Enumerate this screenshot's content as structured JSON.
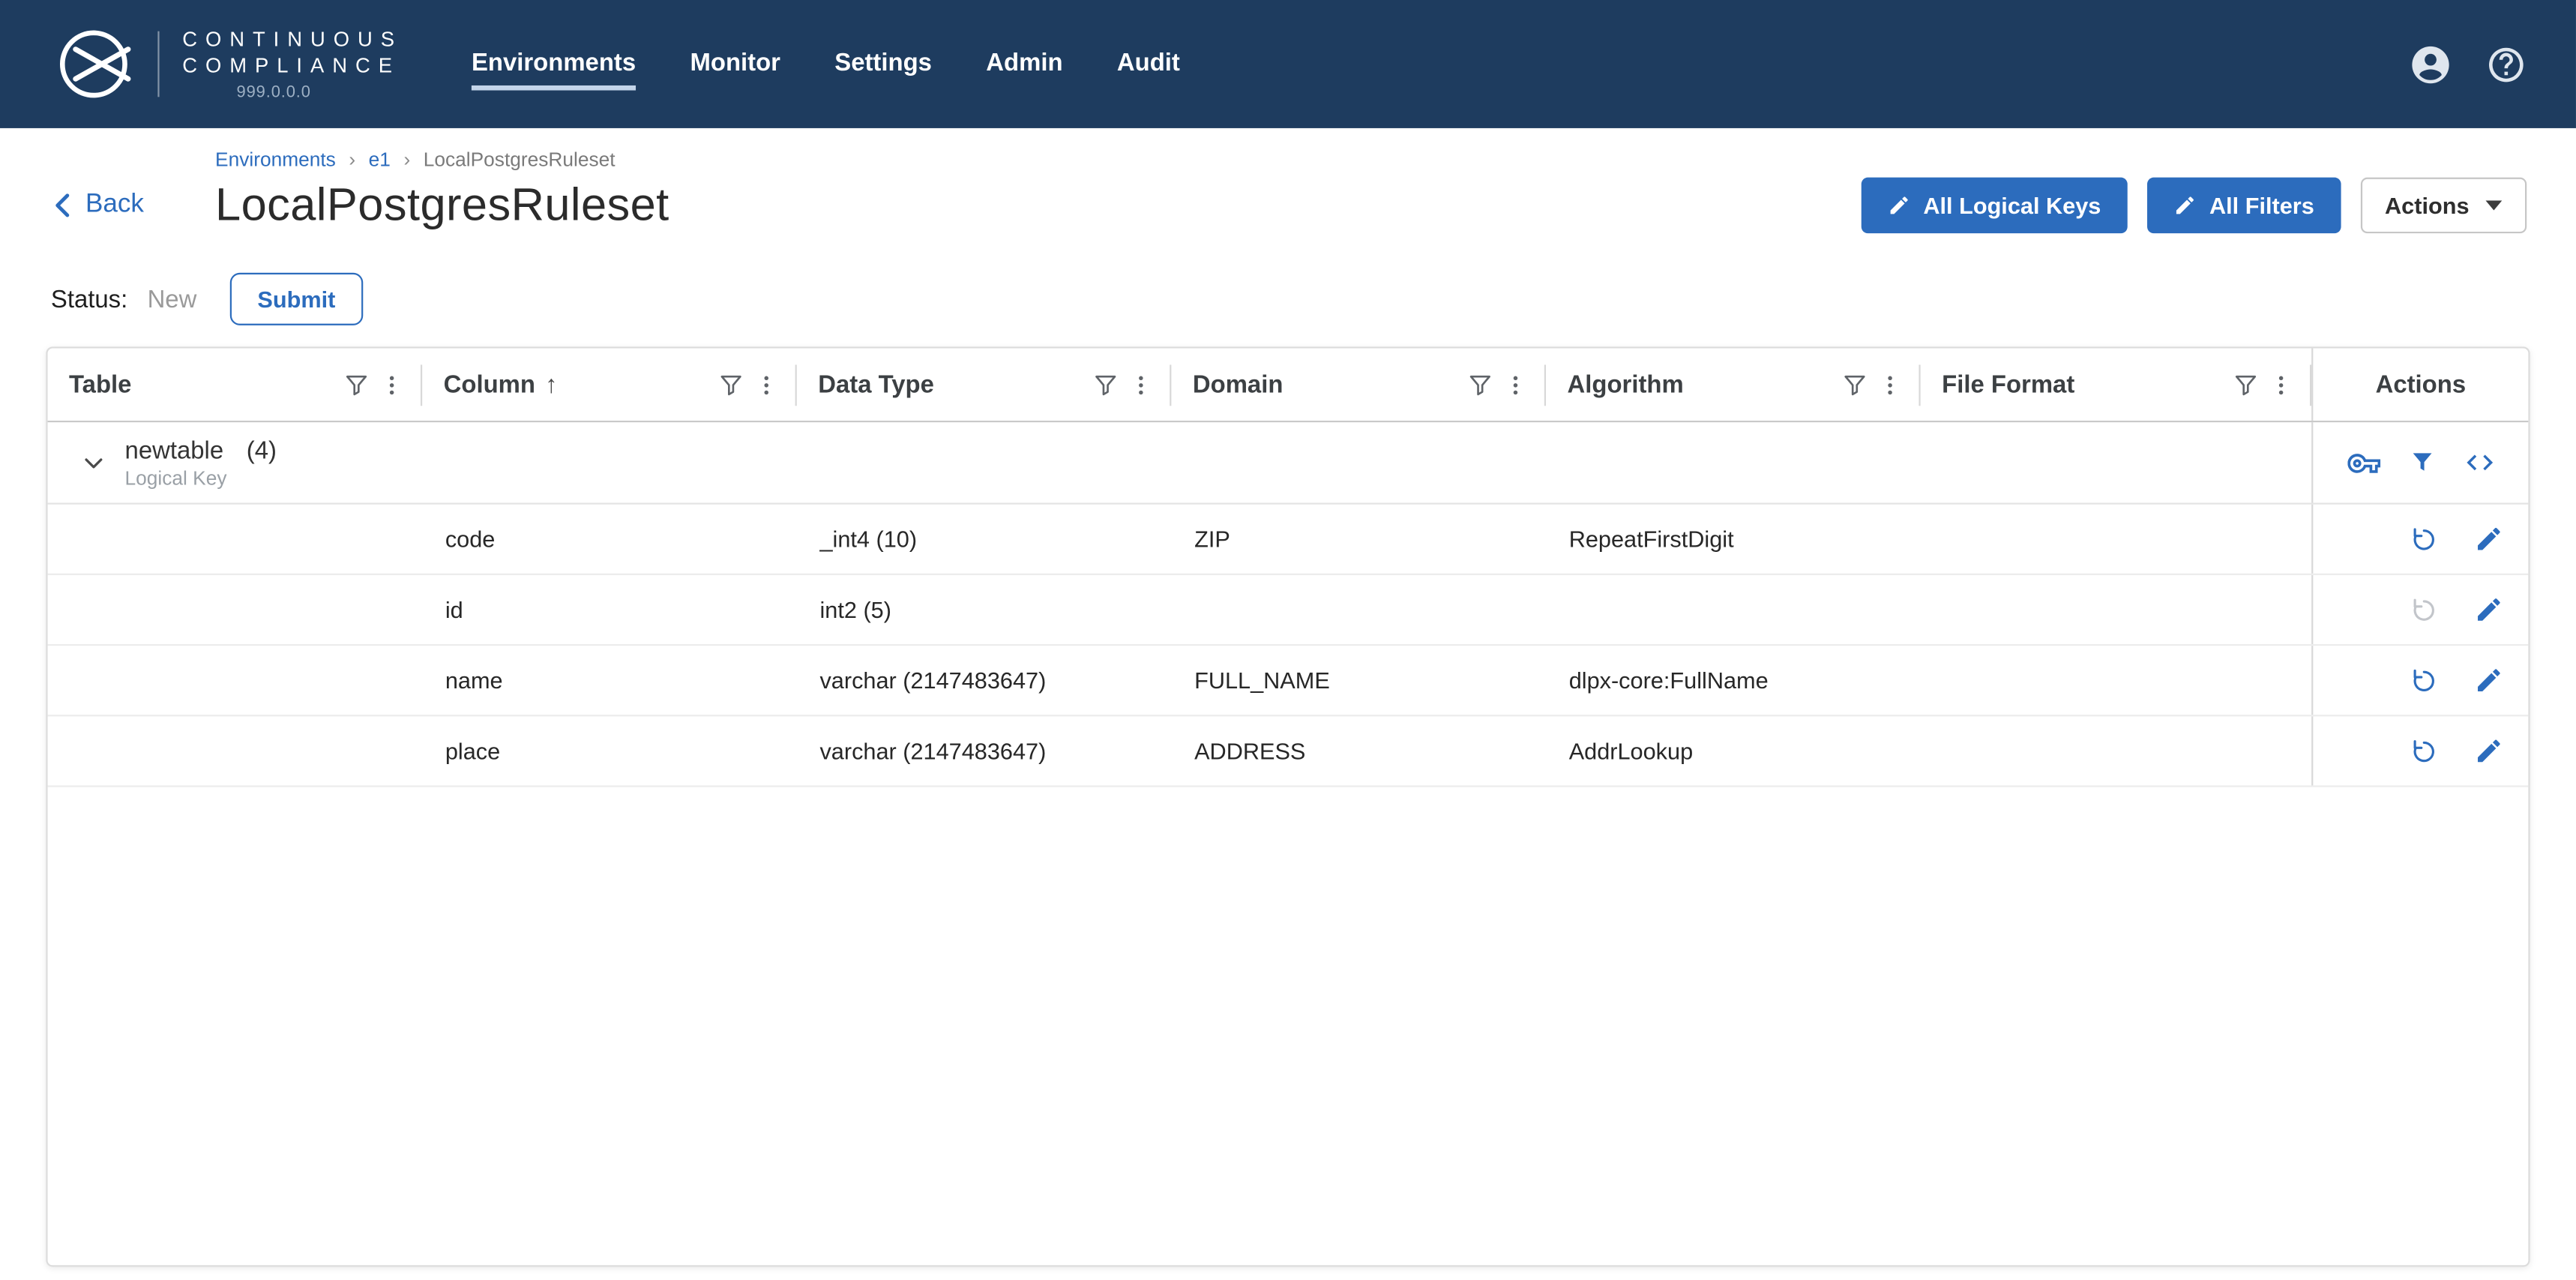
{
  "colors": {
    "navy": "#1e3c5f",
    "accent": "#2c6cbd",
    "disabled_icon": "#c2c5ca"
  },
  "nav": {
    "brand_line1": "CONTINUOUS",
    "brand_line2": "COMPLIANCE",
    "version": "999.0.0.0",
    "items": [
      {
        "label": "Environments",
        "active": true
      },
      {
        "label": "Monitor",
        "active": false
      },
      {
        "label": "Settings",
        "active": false
      },
      {
        "label": "Admin",
        "active": false
      },
      {
        "label": "Audit",
        "active": false
      }
    ],
    "icons": [
      "delphix-logo",
      "account-circle",
      "help-circle"
    ]
  },
  "breadcrumb": {
    "separator": "›",
    "items": [
      "Environments",
      "e1",
      "LocalPostgresRuleset"
    ]
  },
  "header": {
    "back_label": "Back",
    "title": "LocalPostgresRuleset",
    "buttons": {
      "all_logical_keys": "All Logical Keys",
      "all_filters": "All Filters",
      "actions": "Actions"
    }
  },
  "status": {
    "label": "Status:",
    "value": "New",
    "submit_label": "Submit"
  },
  "table": {
    "columns": {
      "table": "Table",
      "column": "Column",
      "data_type": "Data Type",
      "domain": "Domain",
      "algorithm": "Algorithm",
      "file_format": "File Format",
      "actions": "Actions"
    },
    "sort": {
      "column": "Column",
      "direction": "ascending"
    },
    "header_icons": [
      "filter-funnel",
      "kebab-menu"
    ],
    "group": {
      "name": "newtable",
      "count": "(4)",
      "subtitle": "Logical Key",
      "action_icons": [
        "logical-key",
        "filter",
        "code"
      ]
    },
    "rows": [
      {
        "column": "code",
        "data_type": "_int4 (10)",
        "domain": "ZIP",
        "algorithm": "RepeatFirstDigit",
        "file_format": "",
        "reset_enabled": true
      },
      {
        "column": "id",
        "data_type": "int2 (5)",
        "domain": "",
        "algorithm": "",
        "file_format": "",
        "reset_enabled": false
      },
      {
        "column": "name",
        "data_type": "varchar (2147483647)",
        "domain": "FULL_NAME",
        "algorithm": "dlpx-core:FullName",
        "file_format": "",
        "reset_enabled": true
      },
      {
        "column": "place",
        "data_type": "varchar (2147483647)",
        "domain": "ADDRESS",
        "algorithm": "AddrLookup",
        "file_format": "",
        "reset_enabled": true
      }
    ],
    "row_action_icons": [
      "reset",
      "edit"
    ]
  }
}
